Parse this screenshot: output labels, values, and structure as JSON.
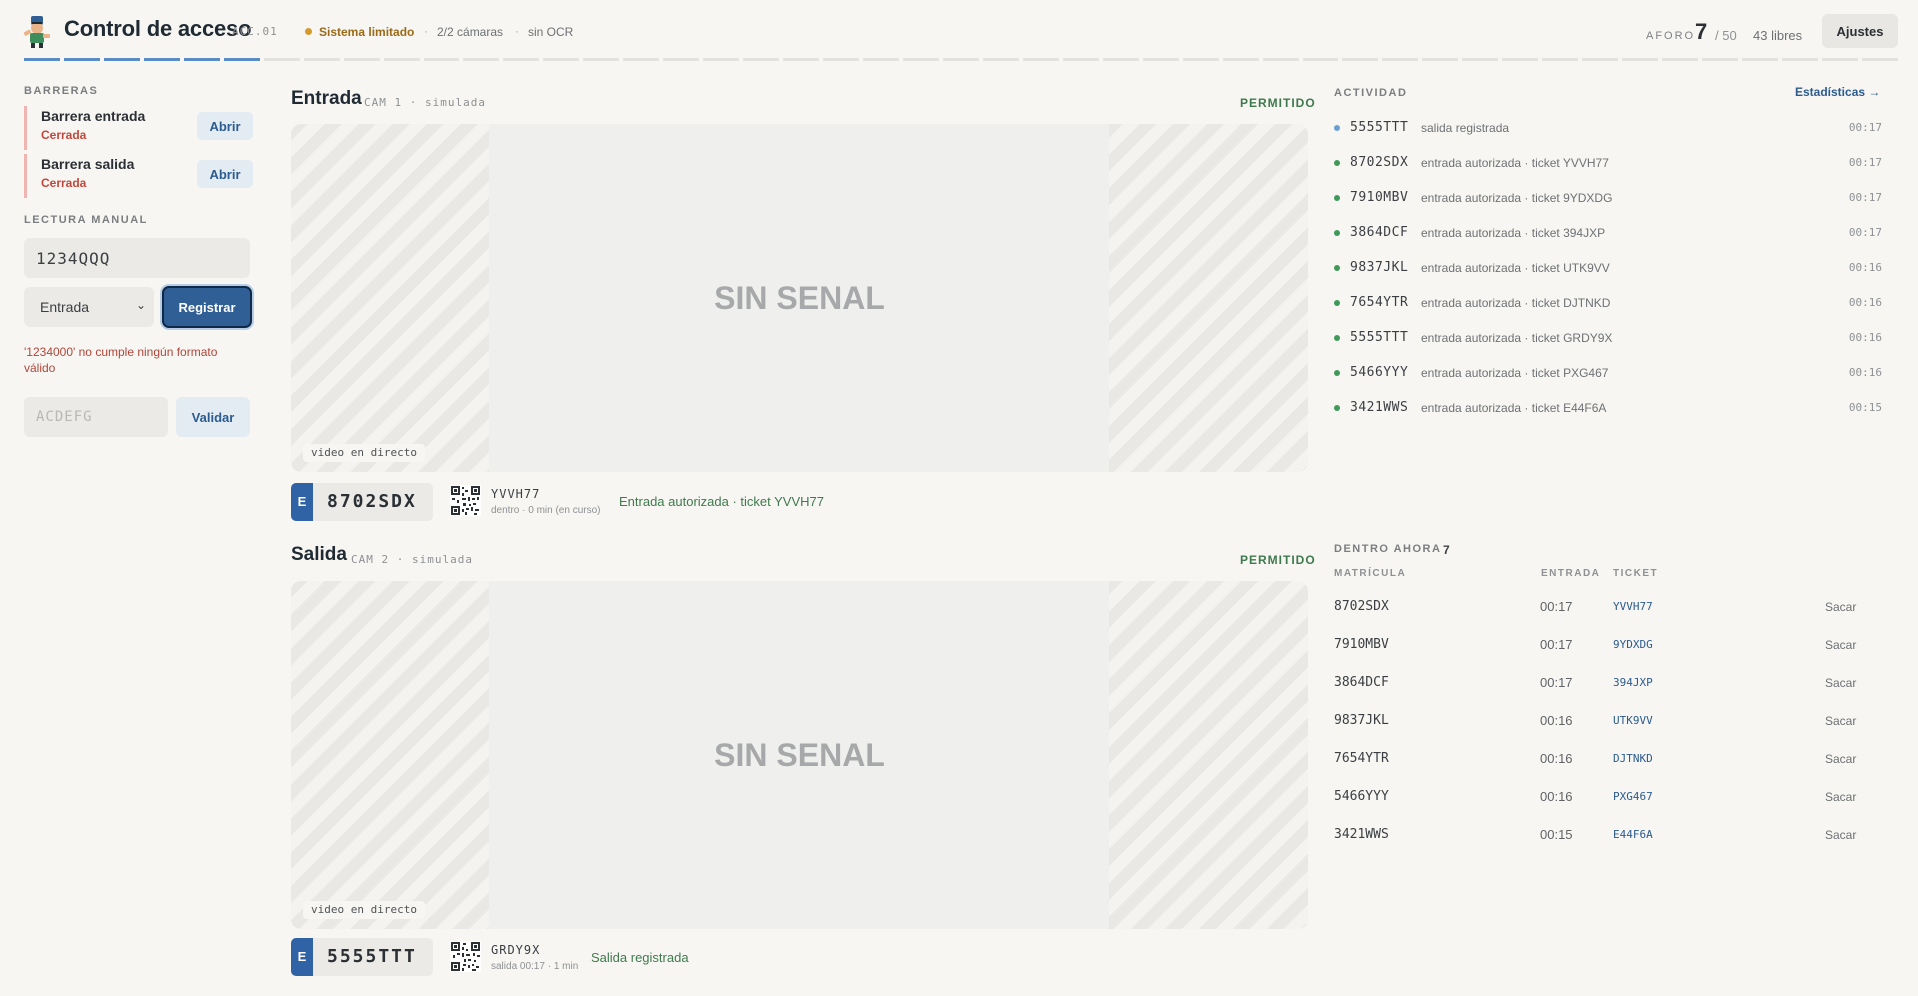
{
  "header": {
    "title": "Control de acceso",
    "code": "ACC.01",
    "status": "Sistema limitado",
    "separator": "·",
    "cameras": "2/2 cámaras",
    "ocr": "sin OCR",
    "aforo_label": "AFORO",
    "aforo_value": "7",
    "aforo_max": "/ 50",
    "aforo_free": "43 libres",
    "settings_label": "Ajustes",
    "status_color": "#d49a2a",
    "progress_segments_total": 47,
    "progress_segments_filled": 6
  },
  "sidebar": {
    "barriers_label": "BARRERAS",
    "barriers": [
      {
        "name": "Barrera entrada",
        "state": "Cerrada",
        "action": "Abrir"
      },
      {
        "name": "Barrera salida",
        "state": "Cerrada",
        "action": "Abrir"
      }
    ],
    "manual_label": "LECTURA MANUAL",
    "plate_value": "1234QQQ",
    "direction": "Entrada",
    "register_label": "Registrar",
    "error": "'1234000' no cumple ningún formato válido",
    "ticket_placeholder": "ACDEFG",
    "validate_label": "Validar"
  },
  "cameras": [
    {
      "title": "Entrada",
      "sub": "CAM 1 · simulada",
      "verdict": "PERMITIDO",
      "signal": "SIN SENAL",
      "live": "video en directo",
      "badge": "E",
      "plate": "8702SDX",
      "ticket": "YVVH77",
      "ticket_info": "dentro · 0 min (en curso)",
      "result": "Entrada autorizada · ticket YVVH77"
    },
    {
      "title": "Salida",
      "sub": "CAM 2 · simulada",
      "verdict": "PERMITIDO",
      "signal": "SIN SENAL",
      "live": "video en directo",
      "badge": "E",
      "plate": "5555TTT",
      "ticket": "GRDY9X",
      "ticket_info": "salida 00:17 · 1 min",
      "result": "Salida registrada"
    }
  ],
  "activity": {
    "label": "ACTIVIDAD",
    "stats_link": "Estadísticas →",
    "items": [
      {
        "plate": "5555TTT",
        "desc": "salida registrada",
        "time": "00:17",
        "color": "#6b9fd4"
      },
      {
        "plate": "8702SDX",
        "desc": "entrada autorizada · ticket YVVH77",
        "time": "00:17",
        "color": "#3f9a5a"
      },
      {
        "plate": "7910MBV",
        "desc": "entrada autorizada · ticket 9YDXDG",
        "time": "00:17",
        "color": "#3f9a5a"
      },
      {
        "plate": "3864DCF",
        "desc": "entrada autorizada · ticket 394JXP",
        "time": "00:17",
        "color": "#3f9a5a"
      },
      {
        "plate": "9837JKL",
        "desc": "entrada autorizada · ticket UTK9VV",
        "time": "00:16",
        "color": "#3f9a5a"
      },
      {
        "plate": "7654YTR",
        "desc": "entrada autorizada · ticket DJTNKD",
        "time": "00:16",
        "color": "#3f9a5a"
      },
      {
        "plate": "5555TTT",
        "desc": "entrada autorizada · ticket GRDY9X",
        "time": "00:16",
        "color": "#3f9a5a"
      },
      {
        "plate": "5466YYY",
        "desc": "entrada autorizada · ticket PXG467",
        "time": "00:16",
        "color": "#3f9a5a"
      },
      {
        "plate": "3421WWS",
        "desc": "entrada autorizada · ticket E44F6A",
        "time": "00:15",
        "color": "#3f9a5a"
      }
    ]
  },
  "inside": {
    "label": "DENTRO AHORA",
    "count": "7",
    "columns": [
      "MATRÍCULA",
      "ENTRADA",
      "TICKET"
    ],
    "rows": [
      {
        "plate": "8702SDX",
        "time": "00:17",
        "ticket": "YVVH77",
        "action": "Sacar"
      },
      {
        "plate": "7910MBV",
        "time": "00:17",
        "ticket": "9YDXDG",
        "action": "Sacar"
      },
      {
        "plate": "3864DCF",
        "time": "00:17",
        "ticket": "394JXP",
        "action": "Sacar"
      },
      {
        "plate": "9837JKL",
        "time": "00:16",
        "ticket": "UTK9VV",
        "action": "Sacar"
      },
      {
        "plate": "7654YTR",
        "time": "00:16",
        "ticket": "DJTNKD",
        "action": "Sacar"
      },
      {
        "plate": "5466YYY",
        "time": "00:16",
        "ticket": "PXG467",
        "action": "Sacar"
      },
      {
        "plate": "3421WWS",
        "time": "00:15",
        "ticket": "E44F6A",
        "action": "Sacar"
      }
    ]
  }
}
